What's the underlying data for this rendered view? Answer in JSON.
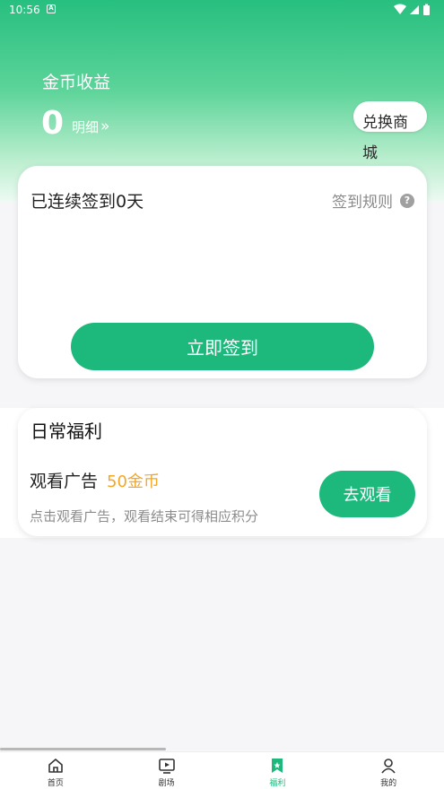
{
  "status": {
    "time": "10:56",
    "notification": "A"
  },
  "coins": {
    "title": "金币收益",
    "value": "0",
    "detail_label": "明细",
    "detail_chevron": "»",
    "exchange_label": "兑换商城"
  },
  "signin": {
    "streak_text": "已连续签到0天",
    "rules_label": "签到规则",
    "rules_icon": "?",
    "button_label": "立即签到"
  },
  "daily": {
    "title": "日常福利",
    "task_title": "观看广告",
    "task_reward": "50金币",
    "task_desc": "点击观看广告，观看结束可得相应积分",
    "task_button": "去观看"
  },
  "tabs": [
    {
      "label": "首页",
      "icon": "home-icon"
    },
    {
      "label": "剧场",
      "icon": "theater-icon"
    },
    {
      "label": "福利",
      "icon": "welfare-icon"
    },
    {
      "label": "我的",
      "icon": "profile-icon"
    }
  ],
  "colors": {
    "accent": "#1db87b",
    "reward": "#f5a623"
  }
}
